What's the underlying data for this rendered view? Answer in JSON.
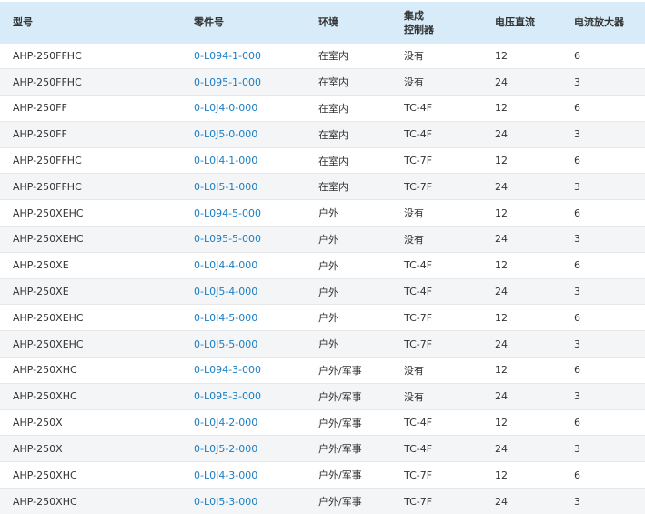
{
  "table": {
    "headers": [
      {
        "key": "model",
        "lines": [
          "型号"
        ]
      },
      {
        "key": "part",
        "lines": [
          "零件号"
        ]
      },
      {
        "key": "env",
        "lines": [
          "环境"
        ]
      },
      {
        "key": "controller",
        "lines": [
          "集成",
          "控制器"
        ]
      },
      {
        "key": "voltage",
        "lines": [
          "电压直流"
        ]
      },
      {
        "key": "amp",
        "lines": [
          "电流放大器"
        ]
      }
    ],
    "rows": [
      [
        "AHP-250FFHC",
        "0-L094-1-000",
        "在室内",
        "没有",
        "12",
        "6"
      ],
      [
        "AHP-250FFHC",
        "0-L095-1-000",
        "在室内",
        "没有",
        "24",
        "3"
      ],
      [
        "AHP-250FF",
        "0-L0J4-0-000",
        "在室内",
        "TC-4F",
        "12",
        "6"
      ],
      [
        "AHP-250FF",
        "0-L0J5-0-000",
        "在室内",
        "TC-4F",
        "24",
        "3"
      ],
      [
        "AHP-250FFHC",
        "0-L0I4-1-000",
        "在室内",
        "TC-7F",
        "12",
        "6"
      ],
      [
        "AHP-250FFHC",
        "0-L0I5-1-000",
        "在室内",
        "TC-7F",
        "24",
        "3"
      ],
      [
        "AHP-250XEHC",
        "0-L094-5-000",
        "户外",
        "没有",
        "12",
        "6"
      ],
      [
        "AHP-250XEHC",
        "0-L095-5-000",
        "户外",
        "没有",
        "24",
        "3"
      ],
      [
        "AHP-250XE",
        "0-L0J4-4-000",
        "户外",
        "TC-4F",
        "12",
        "6"
      ],
      [
        "AHP-250XE",
        "0-L0J5-4-000",
        "户外",
        "TC-4F",
        "24",
        "3"
      ],
      [
        "AHP-250XEHC",
        "0-L0I4-5-000",
        "户外",
        "TC-7F",
        "12",
        "6"
      ],
      [
        "AHP-250XEHC",
        "0-L0I5-5-000",
        "户外",
        "TC-7F",
        "24",
        "3"
      ],
      [
        "AHP-250XHC",
        "0-L094-3-000",
        "户外/军事",
        "没有",
        "12",
        "6"
      ],
      [
        "AHP-250XHC",
        "0-L095-3-000",
        "户外/军事",
        "没有",
        "24",
        "3"
      ],
      [
        "AHP-250X",
        "0-L0J4-2-000",
        "户外/军事",
        "TC-4F",
        "12",
        "6"
      ],
      [
        "AHP-250X",
        "0-L0J5-2-000",
        "户外/军事",
        "TC-4F",
        "24",
        "3"
      ],
      [
        "AHP-250XHC",
        "0-L0I4-3-000",
        "户外/军事",
        "TC-7F",
        "12",
        "6"
      ],
      [
        "AHP-250XHC",
        "0-L0I5-3-000",
        "户外/军事",
        "TC-7F",
        "24",
        "3"
      ]
    ]
  },
  "colors": {
    "header_bg": "#d7ecf8",
    "link": "#1a7ec4",
    "stripe": "#f4f5f6",
    "text": "#333333"
  }
}
